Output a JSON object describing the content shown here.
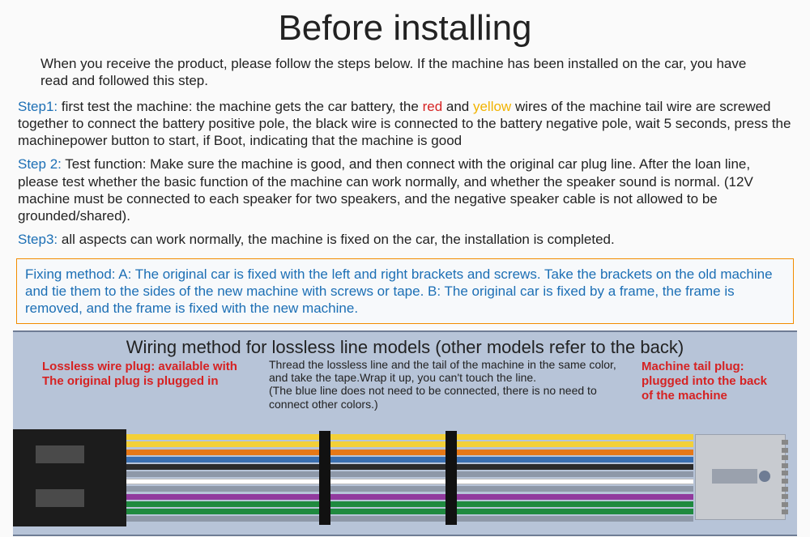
{
  "title": "Before installing",
  "intro": "When you receive the product, please follow the steps below. If the machine has been installed on the car, you have read and followed this step.",
  "step1": {
    "label": "Step1:",
    "a": " first test the machine: the machine gets the car battery, the ",
    "red": "red",
    "b": " and ",
    "yellow": "yellow",
    "c": " wires of the machine tail wire are screwed together to connect the battery positive pole, the black wire is connected to the battery negative pole, wait 5 seconds, press the machinepower button to start, if Boot, indicating that the machine is good"
  },
  "step2": {
    "label": "Step 2:",
    "text": " Test function: Make sure the machine is good, and then connect with the original car plug line. After the loan line, please test whether the basic function of the machine can work normally, and whether the speaker sound is normal. (12V machine must be connected to each speaker for two speakers, and the negative speaker cable is not allowed to be grounded/shared)."
  },
  "step3": {
    "label": "Step3:",
    "text": " all aspects can work normally, the machine is fixed on the car, the installation is completed."
  },
  "fixing": "Fixing method: A: The original car is fixed with the left and right brackets and screws. Take the brackets on the old machine and tie them to the sides of the new machine with screws or tape. B: The original car is fixed by a frame, the frame is removed, and the frame is fixed with the new machine.",
  "wiring": {
    "title": "Wiring method for lossless line models (other models refer to the back)",
    "left_label": "Lossless wire plug: available with\nThe original plug is plugged in",
    "mid_label": "Thread the lossless line and the tail of the machine in the same color, and take the tape.Wrap it up, you can't touch the line.\n (The blue line does not need to be connected, there is no need to connect other colors.)",
    "right_label": "Machine tail plug: plugged into the back of the machine",
    "wire_colors": [
      "#f3d038",
      "#f3d038",
      "#e67817",
      "#3a6fb0",
      "#2b2b2b",
      "#8e98a8",
      "#ffffff",
      "#8e98a8",
      "#913a9e",
      "#1f8a3f",
      "#1f8a3f",
      "#8e98a8"
    ]
  }
}
